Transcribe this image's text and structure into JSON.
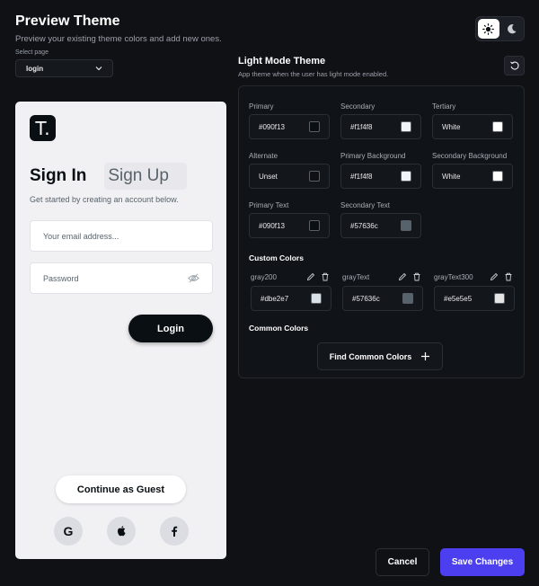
{
  "header": {
    "title": "Preview Theme",
    "subtitle": "Preview your existing theme colors and add new ones.",
    "select_label": "Select page",
    "select_value": "login"
  },
  "mode_toggle": {
    "light_icon": "sun-icon",
    "dark_icon": "moon-icon",
    "active": "light"
  },
  "preview": {
    "logo_letter": "T.",
    "tab_sign_in": "Sign In",
    "tab_sign_up": "Sign Up",
    "description": "Get started by creating an account below.",
    "email_placeholder": "Your email address...",
    "password_placeholder": "Password",
    "login_label": "Login",
    "guest_label": "Continue as Guest",
    "social": [
      "google-icon",
      "apple-icon",
      "facebook-icon"
    ]
  },
  "theme_panel": {
    "title": "Light Mode Theme",
    "subtitle": "App theme when the user has light mode enabled.",
    "colors": [
      {
        "label": "Primary",
        "value": "#090f13",
        "swatch": "#090f13"
      },
      {
        "label": "Secondary",
        "value": "#f1f4f8",
        "swatch": "#f1f4f8"
      },
      {
        "label": "Tertiary",
        "value": "White",
        "swatch": "#ffffff"
      },
      {
        "label": "Alternate",
        "value": "Unset",
        "swatch": "#0f1115"
      },
      {
        "label": "Primary Background",
        "value": "#f1f4f8",
        "swatch": "#f1f4f8"
      },
      {
        "label": "Secondary Background",
        "value": "White",
        "swatch": "#ffffff"
      },
      {
        "label": "Primary Text",
        "value": "#090f13",
        "swatch": "#090f13"
      },
      {
        "label": "Secondary Text",
        "value": "#57636c",
        "swatch": "#57636c"
      }
    ],
    "custom_title": "Custom Colors",
    "custom_colors": [
      {
        "name": "gray200",
        "value": "#dbe2e7",
        "swatch": "#dbe2e7"
      },
      {
        "name": "grayText",
        "value": "#57636c",
        "swatch": "#57636c"
      },
      {
        "name": "grayText300",
        "value": "#e5e5e5",
        "swatch": "#e5e5e5"
      }
    ],
    "common_title": "Common Colors",
    "find_common_label": "Find Common Colors"
  },
  "footer": {
    "cancel_label": "Cancel",
    "save_label": "Save Changes"
  },
  "accent_color": "#4b3ff0"
}
